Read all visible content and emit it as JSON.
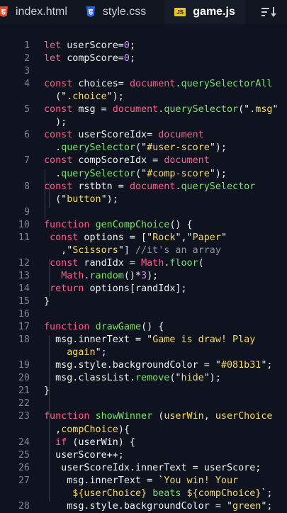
{
  "tabs": [
    {
      "label": "index.html",
      "icon": "html5-icon",
      "color": "#e44d26"
    },
    {
      "label": "style.css",
      "icon": "css3-icon",
      "color": "#2965f1"
    },
    {
      "label": "game.js",
      "icon": "js-icon",
      "color": "#e8c520",
      "badge": "JS",
      "active": true
    }
  ],
  "colors": {
    "keyword": "#ff5c8a",
    "function": "#79e36b",
    "string": "#f6d96a",
    "number": "#c98df2",
    "comment": "#8f95a3"
  },
  "lines": [
    {
      "n": "1",
      "segs": [
        [
          "kw",
          "let"
        ],
        [
          "id",
          " userScore="
        ],
        [
          "num",
          "0"
        ],
        [
          "id",
          ";"
        ]
      ]
    },
    {
      "n": "2",
      "segs": [
        [
          "kw",
          "let"
        ],
        [
          "id",
          " compScore="
        ],
        [
          "num",
          "0"
        ],
        [
          "id",
          ";"
        ]
      ]
    },
    {
      "n": "3",
      "segs": []
    },
    {
      "n": "4",
      "segs": [
        [
          "kw",
          "const"
        ],
        [
          "id",
          " choices= "
        ],
        [
          "kw",
          "document"
        ],
        [
          "id",
          "."
        ],
        [
          "fn",
          "querySelectorAll"
        ]
      ]
    },
    {
      "n": "",
      "segs": [
        [
          "id",
          "  (\""
        ],
        [
          "str",
          ".choice"
        ],
        [
          "id",
          "\");"
        ]
      ]
    },
    {
      "n": "5",
      "segs": [
        [
          "kw",
          "const"
        ],
        [
          "id",
          " msg = "
        ],
        [
          "kw",
          "document"
        ],
        [
          "id",
          "."
        ],
        [
          "fn",
          "querySelector"
        ],
        [
          "id",
          "(\""
        ],
        [
          "str",
          ".msg"
        ],
        [
          "id",
          "\""
        ]
      ]
    },
    {
      "n": "",
      "segs": [
        [
          "id",
          "  );"
        ]
      ]
    },
    {
      "n": "6",
      "segs": [
        [
          "kw",
          "const"
        ],
        [
          "id",
          " userScoreIdx= "
        ],
        [
          "kw",
          "document"
        ]
      ]
    },
    {
      "n": "",
      "segs": [
        [
          "id",
          "  ."
        ],
        [
          "fn",
          "querySelector"
        ],
        [
          "id",
          "(\""
        ],
        [
          "str",
          "#user-score"
        ],
        [
          "id",
          "\");"
        ]
      ]
    },
    {
      "n": "7",
      "segs": [
        [
          "kw",
          "const"
        ],
        [
          "id",
          " compScoreIdx = "
        ],
        [
          "kw",
          "document"
        ]
      ]
    },
    {
      "n": "",
      "segs": [
        [
          "id",
          "  ."
        ],
        [
          "fn",
          "querySelector"
        ],
        [
          "id",
          "(\""
        ],
        [
          "str",
          "#comp-score"
        ],
        [
          "id",
          "\");"
        ]
      ]
    },
    {
      "n": "8",
      "segs": [
        [
          "kw",
          "const"
        ],
        [
          "id",
          " rstbtn = "
        ],
        [
          "kw",
          "document"
        ],
        [
          "id",
          "."
        ],
        [
          "fn",
          "querySelector"
        ]
      ]
    },
    {
      "n": "",
      "segs": [
        [
          "id",
          "  (\""
        ],
        [
          "str",
          "button"
        ],
        [
          "id",
          "\");"
        ]
      ]
    },
    {
      "n": "9",
      "segs": []
    },
    {
      "n": "10",
      "segs": [
        [
          "kw",
          "function"
        ],
        [
          "id",
          " "
        ],
        [
          "fn",
          "genCompChoice"
        ],
        [
          "id",
          "() {"
        ]
      ]
    },
    {
      "n": "11",
      "segs": [
        [
          "id",
          " "
        ],
        [
          "kw",
          "const"
        ],
        [
          "id",
          " options = [\""
        ],
        [
          "str",
          "Rock"
        ],
        [
          "id",
          "\",\""
        ],
        [
          "str",
          "Paper"
        ],
        [
          "id",
          "\""
        ]
      ]
    },
    {
      "n": "",
      "segs": [
        [
          "id",
          "   ,\""
        ],
        [
          "str",
          "Scissors"
        ],
        [
          "id",
          "\"] "
        ],
        [
          "com",
          "//it's an array"
        ]
      ]
    },
    {
      "n": "12",
      "segs": [
        [
          "id",
          " "
        ],
        [
          "kw",
          "const"
        ],
        [
          "id",
          " randIdx = "
        ],
        [
          "kw",
          "Math"
        ],
        [
          "id",
          "."
        ],
        [
          "fn",
          "floor"
        ],
        [
          "id",
          "("
        ]
      ]
    },
    {
      "n": "13",
      "segs": [
        [
          "id",
          "   "
        ],
        [
          "kw",
          "Math"
        ],
        [
          "id",
          "."
        ],
        [
          "fn",
          "random"
        ],
        [
          "id",
          "()*"
        ],
        [
          "num",
          "3"
        ],
        [
          "id",
          ");"
        ]
      ]
    },
    {
      "n": "14",
      "segs": [
        [
          "id",
          " "
        ],
        [
          "kw",
          "return"
        ],
        [
          "id",
          " options[randIdx];"
        ]
      ]
    },
    {
      "n": "15",
      "segs": [
        [
          "id",
          "}"
        ]
      ]
    },
    {
      "n": "16",
      "segs": []
    },
    {
      "n": "17",
      "segs": [
        [
          "kw",
          "function"
        ],
        [
          "id",
          " "
        ],
        [
          "fn",
          "drawGame"
        ],
        [
          "id",
          "() {"
        ]
      ]
    },
    {
      "n": "18",
      "segs": [
        [
          "id",
          "  msg.innerText = \""
        ],
        [
          "str",
          "Game is draw! Play"
        ]
      ]
    },
    {
      "n": "",
      "segs": [
        [
          "str",
          "    again"
        ],
        [
          "id",
          "\";"
        ]
      ]
    },
    {
      "n": "19",
      "segs": [
        [
          "id",
          "  msg.style.backgroundColor = \""
        ],
        [
          "str",
          "#081b31"
        ],
        [
          "id",
          "\";"
        ]
      ]
    },
    {
      "n": "20",
      "segs": [
        [
          "id",
          "  msg.classList."
        ],
        [
          "fn",
          "remove"
        ],
        [
          "id",
          "(\""
        ],
        [
          "str",
          "hide"
        ],
        [
          "id",
          "\");"
        ]
      ]
    },
    {
      "n": "21",
      "segs": [
        [
          "id",
          "}"
        ]
      ]
    },
    {
      "n": "22",
      "segs": []
    },
    {
      "n": "23",
      "segs": [
        [
          "kw",
          "function"
        ],
        [
          "id",
          " "
        ],
        [
          "fn",
          "showWinner"
        ],
        [
          "id",
          " ("
        ],
        [
          "str",
          "userWin"
        ],
        [
          "id",
          ", "
        ],
        [
          "str",
          "userChoice"
        ]
      ]
    },
    {
      "n": "",
      "segs": [
        [
          "id",
          "  ,"
        ],
        [
          "str",
          "compChoice"
        ],
        [
          "id",
          "){"
        ]
      ]
    },
    {
      "n": "24",
      "segs": [
        [
          "id",
          "  "
        ],
        [
          "kw",
          "if"
        ],
        [
          "id",
          " (userWin) {"
        ]
      ]
    },
    {
      "n": "25",
      "segs": [
        [
          "id",
          "  userScore++;"
        ]
      ]
    },
    {
      "n": "26",
      "segs": [
        [
          "id",
          "   userScoreIdx.innerText = userScore;"
        ]
      ]
    },
    {
      "n": "27",
      "segs": [
        [
          "id",
          "    msg.innerText = `"
        ],
        [
          "str",
          "You win! Your"
        ]
      ]
    },
    {
      "n": "",
      "segs": [
        [
          "str",
          "     ${userChoice} "
        ],
        [
          "fn",
          "beats"
        ],
        [
          "str",
          " ${compChoice}"
        ],
        [
          "id",
          "`;"
        ]
      ]
    },
    {
      "n": "28",
      "segs": [
        [
          "id",
          "    msg.style.backgroundColor = \""
        ],
        [
          "str",
          "green"
        ],
        [
          "id",
          "\";"
        ]
      ]
    }
  ]
}
